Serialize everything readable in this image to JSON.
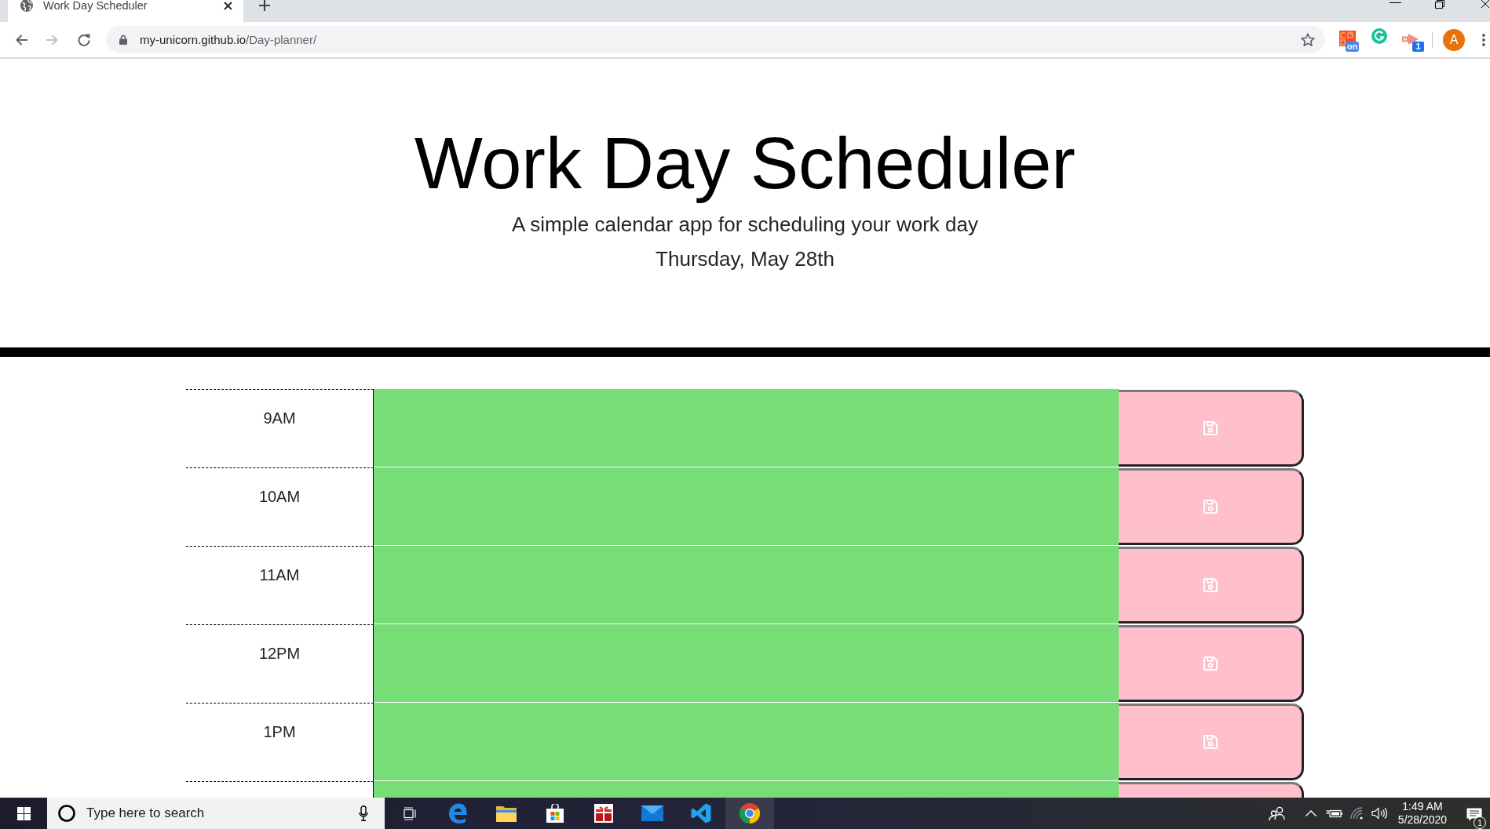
{
  "browser": {
    "tab": {
      "title": "Work Day Scheduler",
      "selected": true
    },
    "nav_buttons": [
      {
        "kind": "back",
        "disabled": false
      },
      {
        "kind": "forward",
        "disabled": true
      },
      {
        "kind": "reload",
        "disabled": false
      }
    ],
    "address": {
      "host": "my-unicorn.github.io",
      "path": "/Day-planner/"
    },
    "extensions": [
      {
        "kind": "coupon",
        "badge": "on"
      },
      {
        "kind": "writing_assistant"
      },
      {
        "kind": "arrow",
        "badge": "1"
      }
    ],
    "profile": {
      "initial": "A"
    }
  },
  "header": {
    "title": "Work Day Scheduler",
    "subtitle": "A simple calendar app for scheduling your work day",
    "date": "Thursday, May 28th"
  },
  "time_blocks": [
    {
      "hour": "9AM",
      "color": "#77dd77"
    },
    {
      "hour": "10AM",
      "color": "#77dd77"
    },
    {
      "hour": "11AM",
      "color": "#77dd77"
    },
    {
      "hour": "12PM",
      "color": "#77dd77"
    },
    {
      "hour": "1PM",
      "color": "#77dd77"
    }
  ],
  "partial_block": {
    "color": "#77dd77"
  },
  "taskbar": {
    "search": {
      "placeholder": "Type here to search"
    },
    "apps": [
      {
        "kind": "task_view",
        "selected": false
      },
      {
        "kind": "browser_e",
        "selected": false
      },
      {
        "kind": "file_explorer",
        "selected": false
      },
      {
        "kind": "store",
        "selected": false
      },
      {
        "kind": "gift",
        "selected": false
      },
      {
        "kind": "mail",
        "selected": false
      },
      {
        "kind": "code_editor",
        "selected": false
      },
      {
        "kind": "browser_chrome",
        "selected": true
      }
    ],
    "clock": {
      "time": "1:49 AM",
      "date": "5/28/2020"
    },
    "notification_count": "1"
  }
}
